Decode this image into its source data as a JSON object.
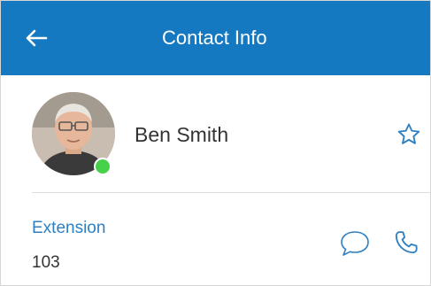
{
  "header": {
    "title": "Contact Info",
    "back_icon": "arrow-left-icon",
    "background_color": "#1479c0"
  },
  "contact": {
    "name": "Ben Smith",
    "presence": "online",
    "presence_color": "#47d14a",
    "favorite_icon": "star-outline-icon"
  },
  "extension": {
    "label": "Extension",
    "value": "103",
    "label_color": "#2f80c2",
    "message_icon": "chat-bubble-icon",
    "call_icon": "phone-icon"
  }
}
